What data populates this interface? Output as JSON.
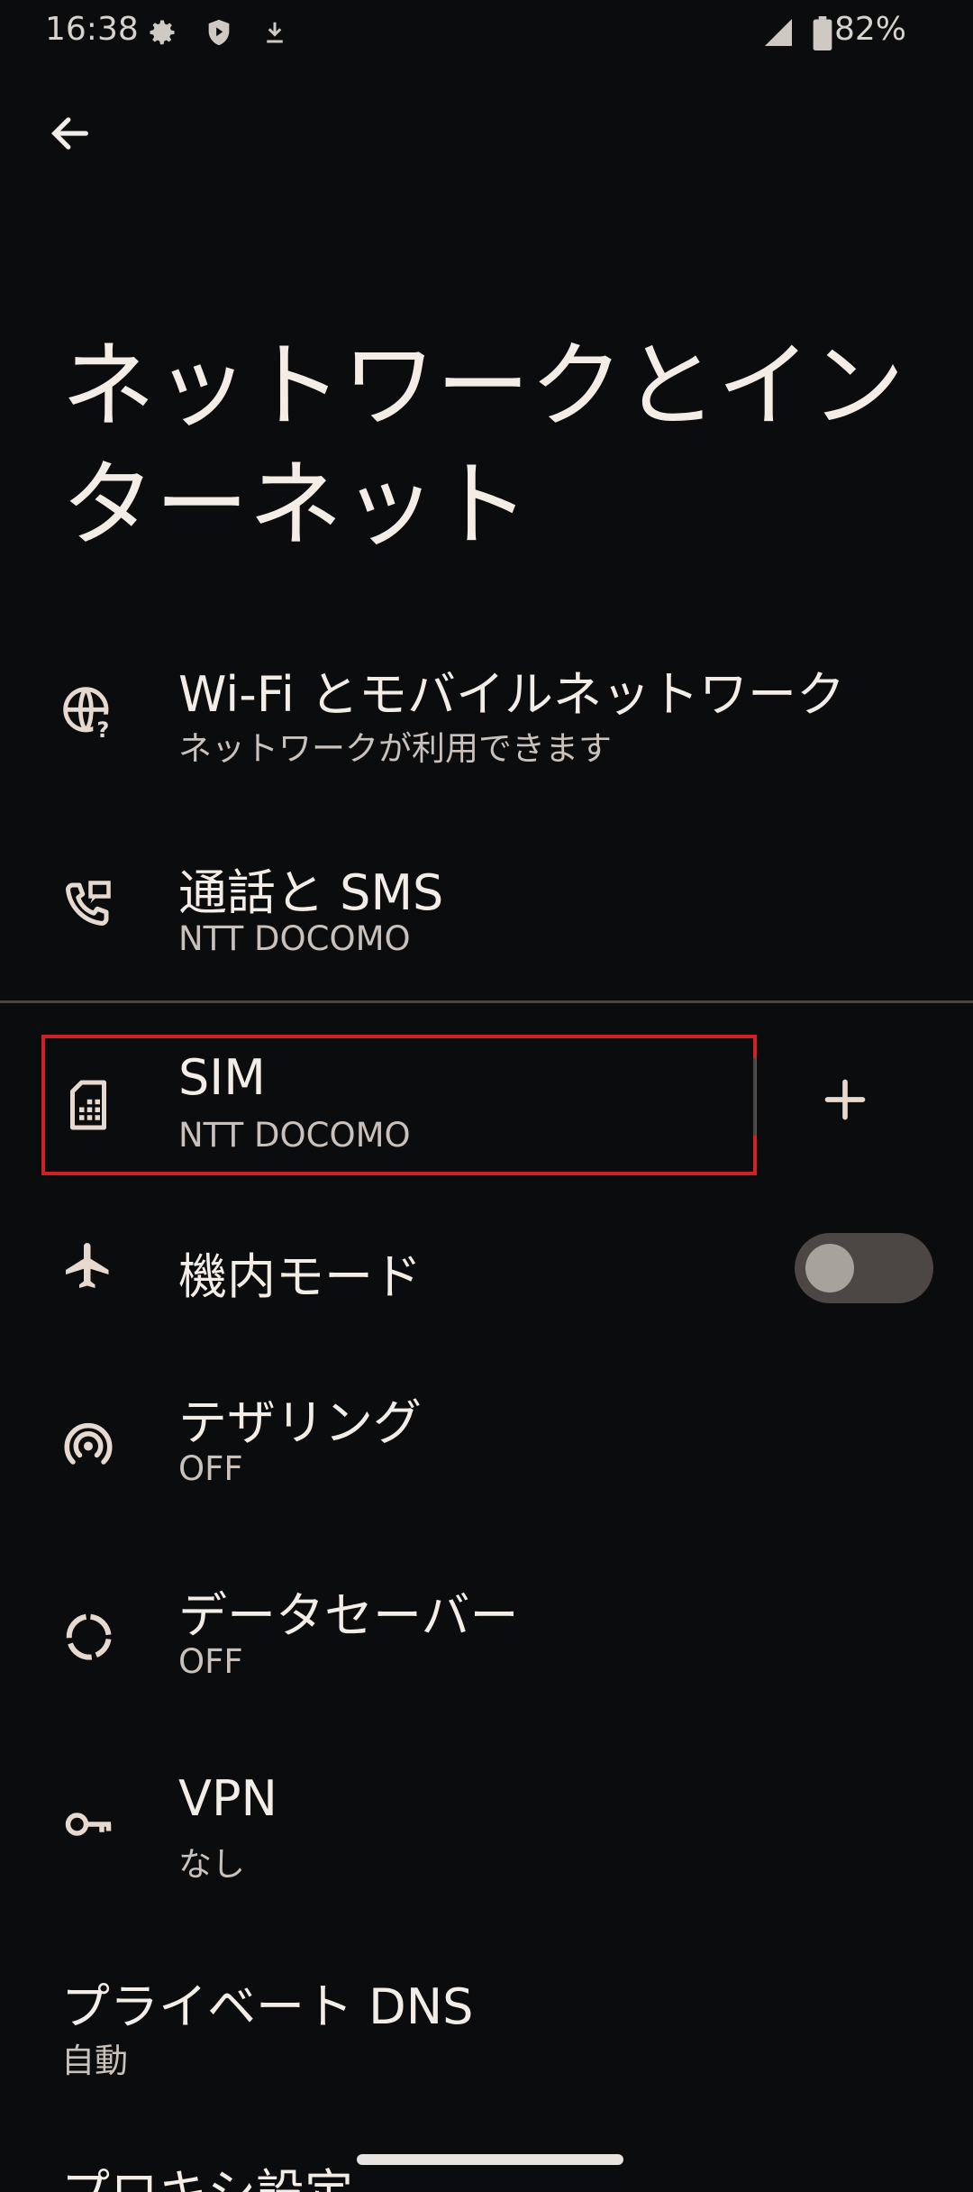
{
  "status_bar": {
    "time": "16:38",
    "battery": "82%",
    "icons": [
      "gear-icon",
      "shield-icon",
      "download-icon",
      "signal-icon",
      "battery-icon"
    ]
  },
  "header": {
    "back_icon": "arrow-left-icon",
    "title": "ネットワークとインターネット"
  },
  "items": {
    "wifi": {
      "title": "Wi-Fi とモバイルネットワーク",
      "subtitle": "ネットワークが利用できます",
      "icon": "globe-question-icon"
    },
    "calls": {
      "title": "通話と SMS",
      "subtitle": "NTT DOCOMO",
      "icon": "phone-message-icon"
    },
    "sim": {
      "title": "SIM",
      "subtitle": "NTT DOCOMO",
      "icon": "sim-card-icon",
      "add_icon": "plus-icon"
    },
    "airplane": {
      "title": "機内モード",
      "icon": "airplane-icon",
      "toggle_on": false
    },
    "tethering": {
      "title": "テザリング",
      "subtitle": "OFF",
      "icon": "hotspot-icon"
    },
    "data_saver": {
      "title": "データセーバー",
      "subtitle": "OFF",
      "icon": "data-saver-icon"
    },
    "vpn": {
      "title": "VPN",
      "subtitle": "なし",
      "icon": "key-icon"
    },
    "private_dns": {
      "title": "プライベート DNS",
      "subtitle": "自動"
    },
    "proxy": {
      "title": "プロキシ設定"
    }
  },
  "colors": {
    "background": "#0b0c0e",
    "highlight_border": "#d22027",
    "icon": "#e8d9cf"
  }
}
